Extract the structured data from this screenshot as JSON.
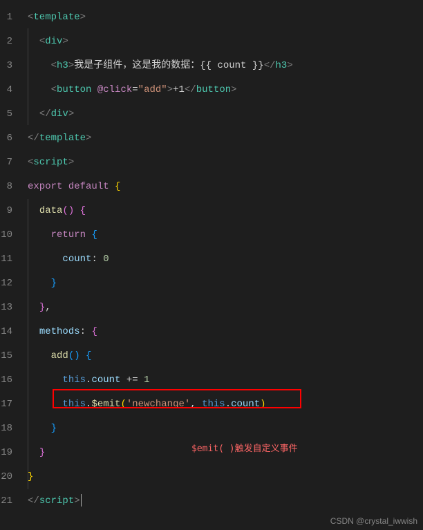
{
  "editor": {
    "line_count": 21,
    "lines": [
      1,
      2,
      3,
      4,
      5,
      6,
      7,
      8,
      9,
      10,
      11,
      12,
      13,
      14,
      15,
      16,
      17,
      18,
      19,
      20,
      21
    ]
  },
  "code": {
    "l1": {
      "open": "<",
      "tag": "template",
      "close": ">"
    },
    "l2": {
      "open": "<",
      "tag": "div",
      "close": ">"
    },
    "l3": {
      "open": "<",
      "tag": "h3",
      "close": ">",
      "text": "我是子组件，这是我的数据：",
      "interp_open": "{{ ",
      "interp_var": "count",
      "interp_close": " }}",
      "endopen": "</",
      "endtag": "h3",
      "endclose": ">"
    },
    "l4": {
      "open": "<",
      "tag": "button",
      "dir": "@click",
      "eq": "=",
      "str": "\"add\"",
      "close": ">",
      "text": "+1",
      "endopen": "</",
      "endtag": "button",
      "endclose": ">"
    },
    "l5": {
      "open": "</",
      "tag": "div",
      "close": ">"
    },
    "l6": {
      "open": "</",
      "tag": "template",
      "close": ">"
    },
    "l7": {
      "open": "<",
      "tag": "script",
      "close": ">"
    },
    "l8": {
      "kw1": "export",
      "kw2": "default",
      "brace": "{"
    },
    "l9": {
      "fn": "data",
      "paren": "()",
      "brace": "{"
    },
    "l10": {
      "kw": "return",
      "brace": "{"
    },
    "l11": {
      "prop": "count",
      "colon": ":",
      "val": "0"
    },
    "l12": {
      "brace": "}"
    },
    "l13": {
      "brace": "}",
      "comma": ","
    },
    "l14": {
      "prop": "methods",
      "colon": ":",
      "brace": "{"
    },
    "l15": {
      "fn": "add",
      "paren": "()",
      "brace": "{"
    },
    "l16": {
      "this": "this",
      "dot1": ".",
      "prop": "count",
      "op": "+=",
      "val": "1"
    },
    "l17": {
      "this1": "this",
      "dot1": ".",
      "emit": "$emit",
      "lp": "(",
      "str": "'newchange'",
      "comma": ", ",
      "this2": "this",
      "dot2": ".",
      "prop": "count",
      "rp": ")"
    },
    "l18": {
      "brace": "}"
    },
    "l19": {
      "brace": "}"
    },
    "l20": {
      "brace": "}"
    },
    "l21": {
      "open": "</",
      "tag": "script",
      "close": ">"
    }
  },
  "annotation": {
    "text": "$emit( )触发自定义事件"
  },
  "watermark": "CSDN @crystal_iwwish"
}
